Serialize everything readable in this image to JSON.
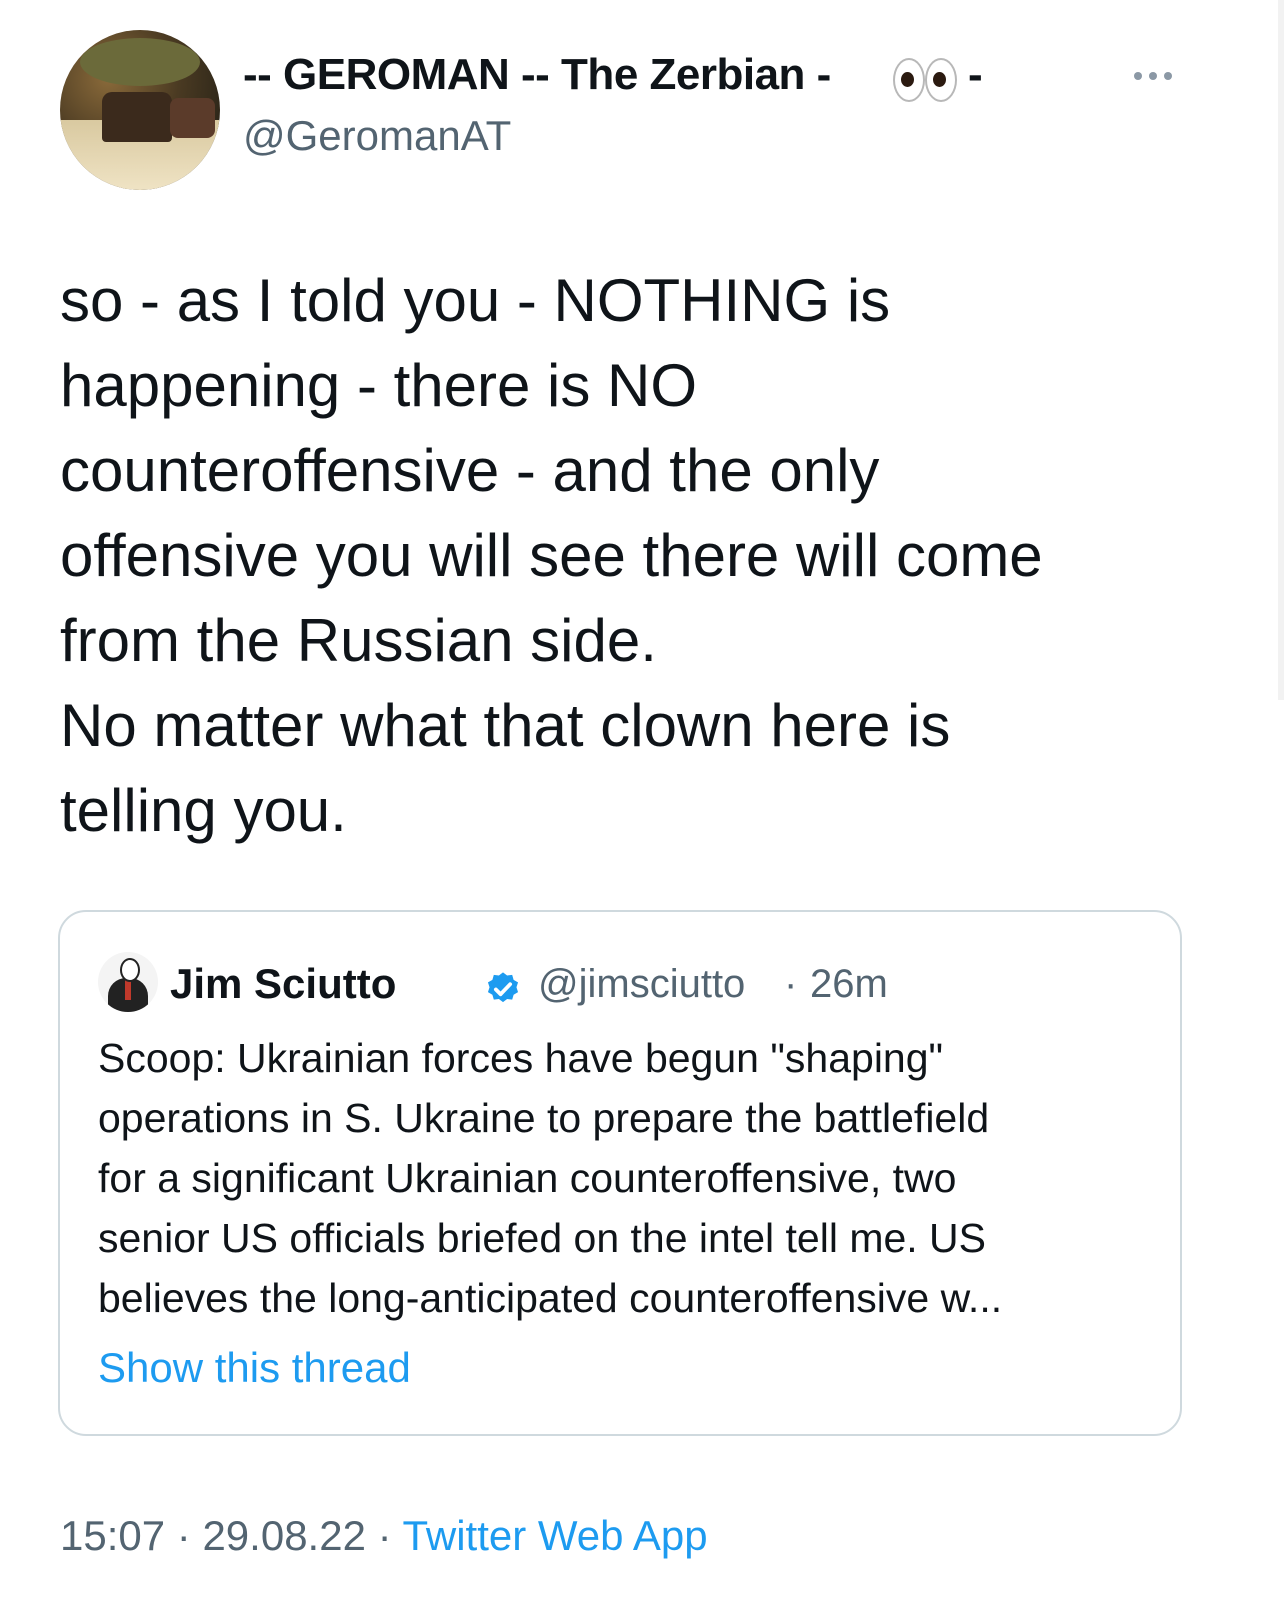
{
  "author": {
    "display_name": "-- GEROMAN -- The Zerbian -",
    "name_emoji": "eyes-emoji",
    "display_name_tail": "-",
    "handle": "@GeromanAT"
  },
  "more_icon": "more-horizontal-icon",
  "tweet_text": "so - as I told you - NOTHING is\nhappening - there is NO\ncounteroffensive - and the only\noffensive you will see there will come\nfrom the Russian side.\nNo matter what that clown here is\ntelling you.",
  "quoted": {
    "name": "Jim Sciutto",
    "verified_icon": "verified-badge-icon",
    "handle": "@jimsciutto",
    "separator": "·",
    "time": "26m",
    "lines": [
      "Scoop: Ukrainian forces have begun \"shaping\"",
      "operations in S. Ukraine to prepare the battlefield",
      "for a significant Ukrainian counteroffensive, two",
      "senior US officials briefed on the intel tell me. US",
      "believes the long-anticipated counteroffensive w..."
    ],
    "show_thread": "Show this thread"
  },
  "footer": {
    "time": "15:07",
    "date": "29.08.22",
    "separator": "·",
    "source": "Twitter Web App"
  },
  "colors": {
    "link": "#1d9bf0",
    "secondary": "#536471",
    "text": "#0f1419",
    "border": "#cfd9de"
  }
}
